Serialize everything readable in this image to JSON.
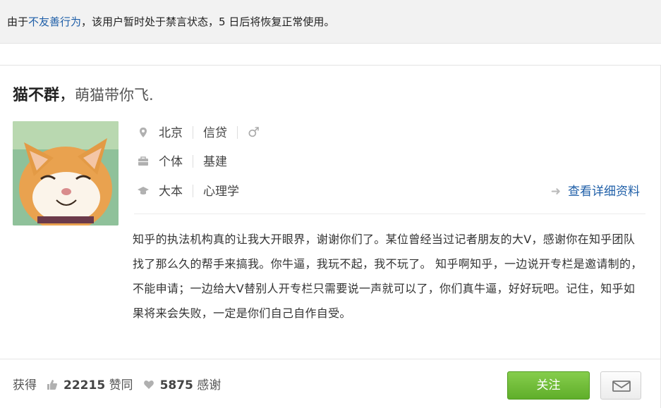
{
  "notice": {
    "prefix": "由于",
    "link": "不友善行为",
    "suffix": "，该用户暂时处于禁言状态，5 日后将恢复正常使用。"
  },
  "profile": {
    "name": "猫不群",
    "separator": "，",
    "motto": "萌猫带你飞.",
    "location": "北京",
    "industry": "信贷",
    "gender_icon": "male-icon",
    "employment": "个体",
    "position": "基建",
    "education": "大本",
    "major": "心理学",
    "detail_link": "查看详细资料",
    "bio": "知乎的执法机构真的让我大开眼界，谢谢你们了。某位曾经当过记者朋友的大V，感谢你在知乎团队找了那么久的帮手来搞我。你牛逼，我玩不起，我不玩了。 知乎啊知乎，一边说开专栏是邀请制的，不能申请；一边给大V替别人开专栏只需要说一声就可以了，你们真牛逼，好好玩吧。记住，知乎如果将来会失败，一定是你们自己自作自受。"
  },
  "stats": {
    "prefix": "获得",
    "agree_count": "22215",
    "agree_label": "赞同",
    "thanks_count": "5875",
    "thanks_label": "感谢"
  },
  "actions": {
    "follow_label": "关注",
    "message_icon": "mail-icon"
  },
  "colors": {
    "link": "#1f5fa8",
    "follow_green": "#6bb935",
    "notice_bg": "#f2f2f2"
  }
}
